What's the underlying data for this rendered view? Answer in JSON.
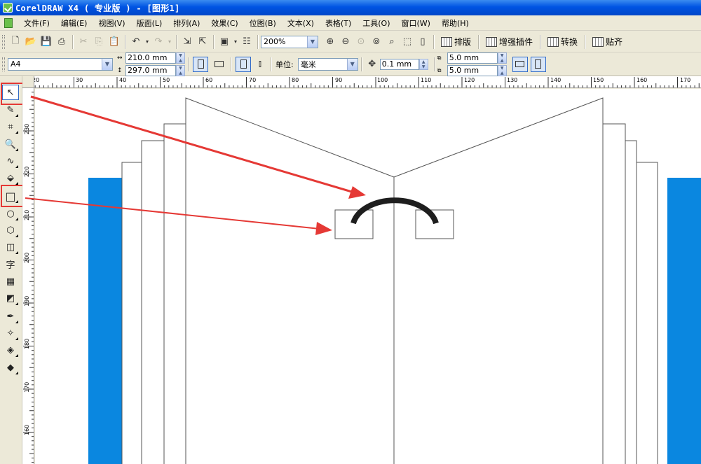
{
  "window": {
    "title": "CorelDRAW X4 ( 专业版 ) - [图形1]"
  },
  "menu": [
    "文件(F)",
    "编辑(E)",
    "视图(V)",
    "版面(L)",
    "排列(A)",
    "效果(C)",
    "位图(B)",
    "文本(X)",
    "表格(T)",
    "工具(O)",
    "窗口(W)",
    "帮助(H)"
  ],
  "toolbar": {
    "zoom_value": "200%",
    "layout_label": "排版",
    "plugin_label": "增强插件",
    "convert_label": "转换",
    "snap_label": "贴齐"
  },
  "property_bar": {
    "paper_size": "A4",
    "width": "210.0 mm",
    "height": "297.0 mm",
    "unit_label": "单位:",
    "unit_value": "毫米",
    "nudge": "0.1 mm",
    "dup_x": "5.0 mm",
    "dup_y": "5.0 mm"
  },
  "rulers": {
    "horizontal": [
      "20",
      "30",
      "40",
      "50",
      "60",
      "70",
      "80",
      "90",
      "100",
      "110",
      "120",
      "130",
      "140",
      "150",
      "160",
      "170"
    ],
    "vertical": [
      "230",
      "220",
      "210",
      "200",
      "190",
      "180",
      "170",
      "160"
    ]
  },
  "toolbox": {
    "tools": [
      {
        "name": "pick-tool",
        "glyph": "↖"
      },
      {
        "name": "shape-tool",
        "glyph": "✎"
      },
      {
        "name": "crop-tool",
        "glyph": "⌗"
      },
      {
        "name": "zoom-tool",
        "glyph": "🔍"
      },
      {
        "name": "freehand-tool",
        "glyph": "∿"
      },
      {
        "name": "smart-fill-tool",
        "glyph": "⬙"
      },
      {
        "name": "rectangle-tool",
        "glyph": "□"
      },
      {
        "name": "ellipse-tool",
        "glyph": "○"
      },
      {
        "name": "polygon-tool",
        "glyph": "⬡"
      },
      {
        "name": "basic-shapes-tool",
        "glyph": "◫"
      },
      {
        "name": "text-tool",
        "glyph": "字"
      },
      {
        "name": "table-tool",
        "glyph": "▦"
      },
      {
        "name": "interactive-blend-tool",
        "glyph": "◩"
      },
      {
        "name": "eyedropper-tool",
        "glyph": "✒"
      },
      {
        "name": "outline-tool",
        "glyph": "✧"
      },
      {
        "name": "fill-tool",
        "glyph": "◈"
      },
      {
        "name": "interactive-fill-tool",
        "glyph": "◆"
      }
    ]
  },
  "colors": {
    "accent_blue": "#0a87e0",
    "highlight_red": "#e53935",
    "arc_stroke": "#1e1e1e"
  }
}
